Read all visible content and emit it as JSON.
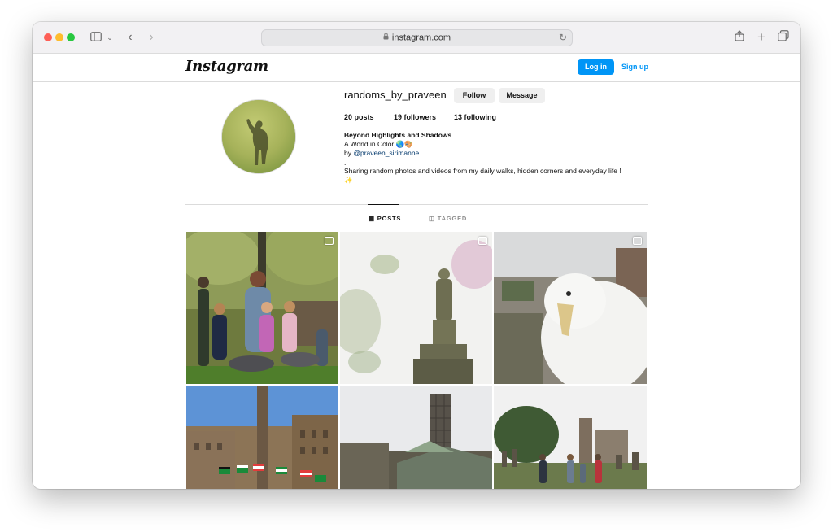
{
  "browser": {
    "url": "instagram.com"
  },
  "header": {
    "logo": "Instagram",
    "login_label": "Log in",
    "signup_label": "Sign up",
    "accent": "#0095f6"
  },
  "profile": {
    "username": "randoms_by_praveen",
    "follow_label": "Follow",
    "message_label": "Message",
    "stats": {
      "posts_count": "20",
      "posts_label": "posts",
      "followers_count": "19",
      "followers_label": "followers",
      "following_count": "13",
      "following_label": "following"
    },
    "bio": {
      "name": "Beyond Highlights and Shadows",
      "line1": "A World in Color 🌏🎨",
      "by_prefix": "by",
      "mention": "@praveen_sirimanne",
      "dot": ".",
      "line2": "Sharing random photos and videos from my daily walks, hidden corners and everyday life !",
      "sparkle": "✨"
    }
  },
  "tabs": [
    {
      "label": "POSTS",
      "active": true,
      "icon": "grid-icon"
    },
    {
      "label": "TAGGED",
      "active": false,
      "icon": "tag-icon"
    }
  ],
  "posts": [
    {
      "name": "family-in-park",
      "multi": true
    },
    {
      "name": "statue-blossoms",
      "multi": true
    },
    {
      "name": "seagull-closeup",
      "multi": true
    },
    {
      "name": "city-chambers-flags",
      "multi": false
    },
    {
      "name": "cathedral-scaffolding",
      "multi": false
    },
    {
      "name": "necropolis-walk",
      "multi": false
    }
  ]
}
